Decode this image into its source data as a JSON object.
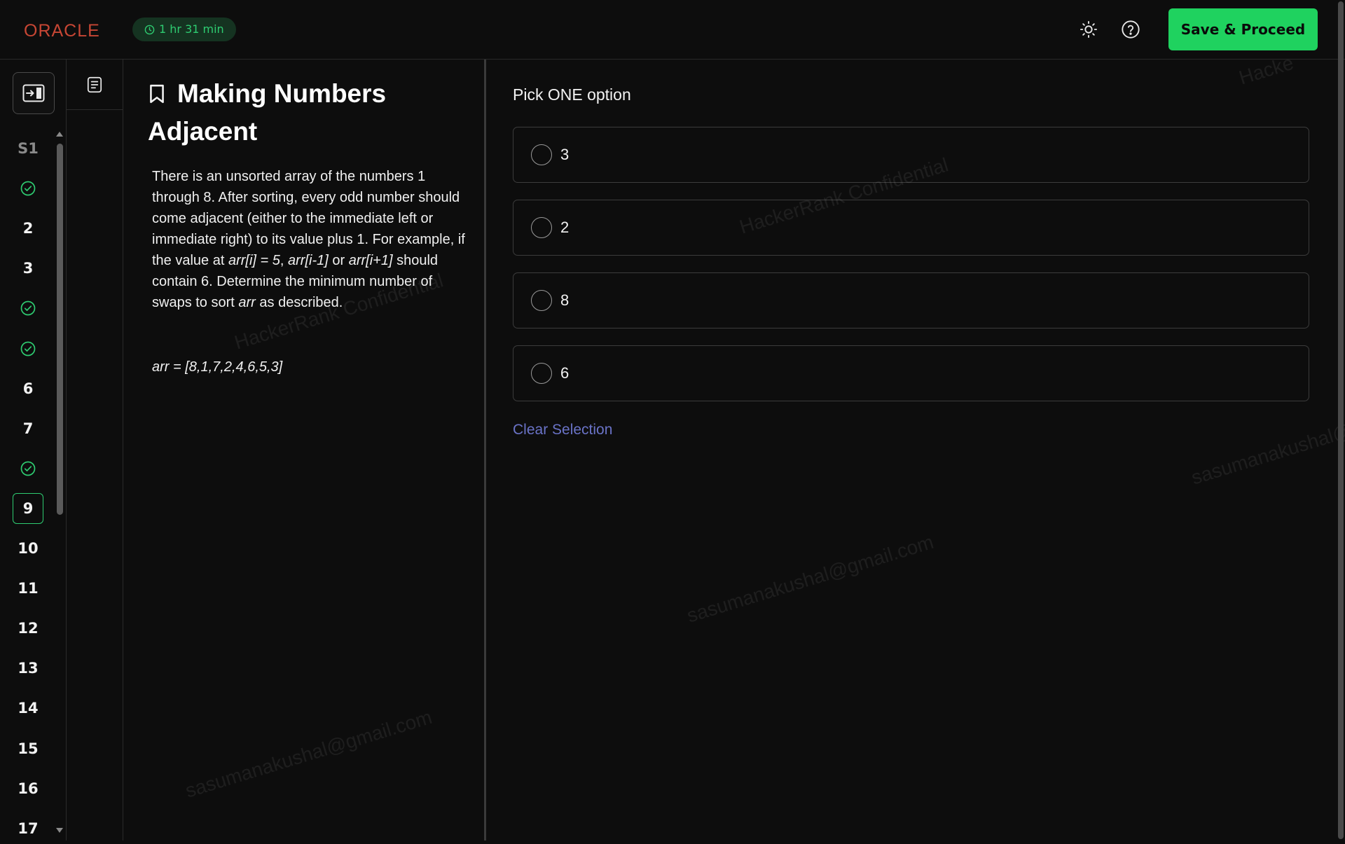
{
  "header": {
    "logo": "ORACLE",
    "timer": "1 hr 31 min",
    "save_label": "Save & Proceed",
    "theme_icon": "sun-icon",
    "help_icon": "help-circle-icon"
  },
  "rail": {
    "items": [
      {
        "label": "S1",
        "kind": "section"
      },
      {
        "label": "",
        "kind": "done"
      },
      {
        "label": "2",
        "kind": "number"
      },
      {
        "label": "3",
        "kind": "number"
      },
      {
        "label": "",
        "kind": "done"
      },
      {
        "label": "",
        "kind": "done"
      },
      {
        "label": "6",
        "kind": "number"
      },
      {
        "label": "7",
        "kind": "number"
      },
      {
        "label": "",
        "kind": "done"
      },
      {
        "label": "9",
        "kind": "current"
      },
      {
        "label": "10",
        "kind": "number"
      },
      {
        "label": "11",
        "kind": "number"
      },
      {
        "label": "12",
        "kind": "number"
      },
      {
        "label": "13",
        "kind": "number"
      },
      {
        "label": "14",
        "kind": "number"
      },
      {
        "label": "15",
        "kind": "number"
      },
      {
        "label": "16",
        "kind": "number"
      },
      {
        "label": "17",
        "kind": "number"
      }
    ]
  },
  "question": {
    "title": "Making Numbers Adjacent",
    "body_1": "There is an unsorted array of the numbers 1 through 8.  After sorting, every odd number should come adjacent (either to the immediate left or immediate right) to its value plus 1.  For example, if the value at ",
    "code_1": "arr[i] = 5",
    "body_2": ", ",
    "code_2": "arr[i-1]",
    "body_3": " or ",
    "code_3": "arr[i+1]",
    "body_4": " should contain 6.  Determine the minimum number of swaps to sort ",
    "code_4": "arr",
    "body_5": " as described.",
    "arr": "arr  = [8,1,7,2,4,6,5,3]"
  },
  "answers": {
    "prompt": "Pick ONE option",
    "options": [
      "3",
      "2",
      "8",
      "6"
    ],
    "clear_label": "Clear Selection"
  },
  "watermarks": {
    "brand": "HackerRank Confidential",
    "email": "sasumanakushal@gmail.com",
    "brand_partial": "Hacke",
    "email_partial": "sasumanakushal@"
  },
  "colors": {
    "accent_green": "#1fd25f",
    "logo_red": "#c74634",
    "link_blue": "#6a73c7"
  }
}
